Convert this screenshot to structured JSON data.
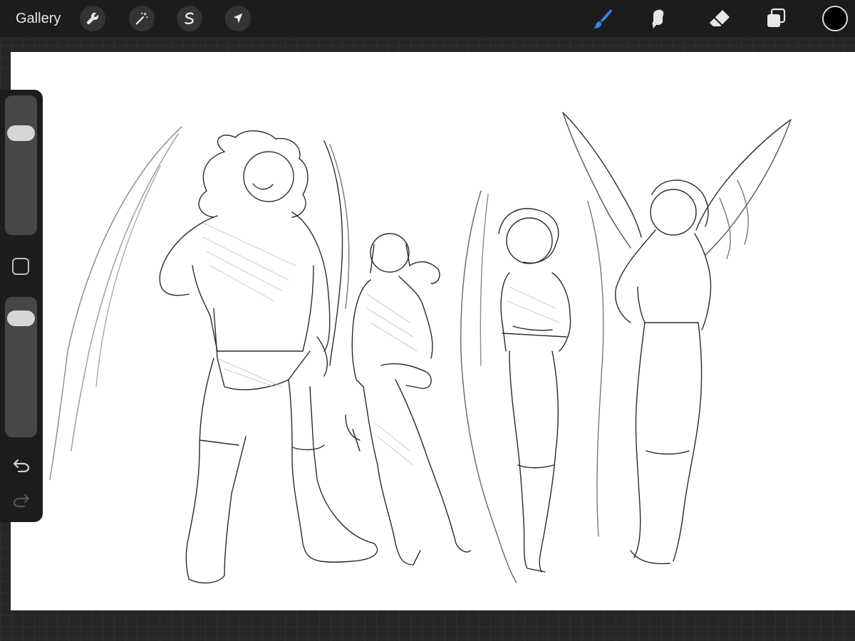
{
  "app": {
    "gallery_label": "Gallery"
  },
  "toolbar_left": [
    {
      "name": "actions-wrench-icon"
    },
    {
      "name": "adjustments-magic-wand-icon"
    },
    {
      "name": "selection-s-icon"
    },
    {
      "name": "transform-arrow-icon"
    }
  ],
  "toolbar_right": [
    {
      "name": "brush-icon",
      "active": true
    },
    {
      "name": "smudge-icon",
      "active": false
    },
    {
      "name": "eraser-icon",
      "active": false
    },
    {
      "name": "layers-icon",
      "active": false
    }
  ],
  "colors": {
    "accent": "#2f86f0",
    "current_color": "#000000",
    "canvas": "#ffffff",
    "icon": "#e6e6e6"
  },
  "sidebar": {
    "brush_size_level": 0.22,
    "opacity_level": 0.08
  }
}
